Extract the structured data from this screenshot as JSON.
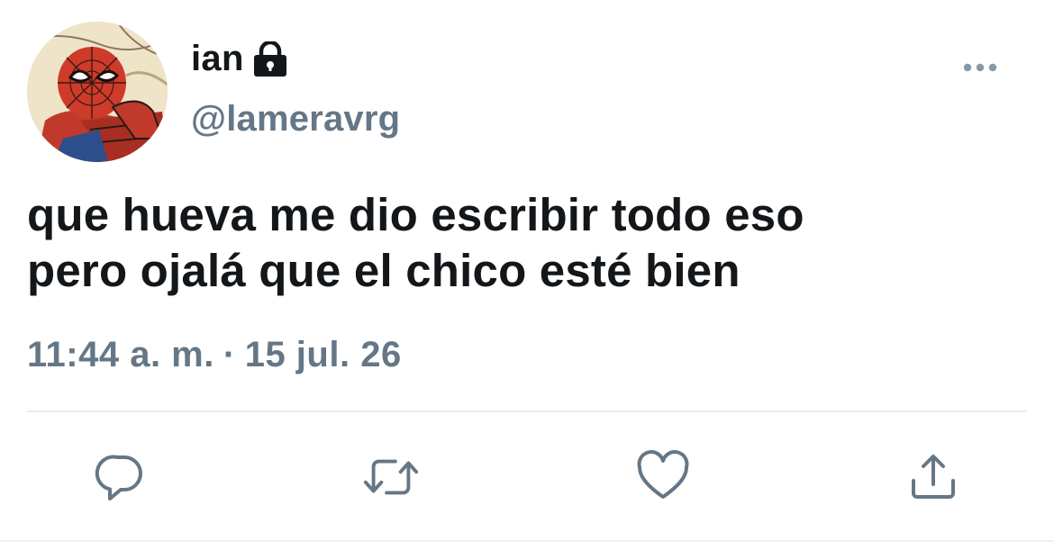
{
  "user": {
    "display_name": "ian",
    "handle": "@lameravrg",
    "avatar": "spiderman-avatar",
    "protected_icon": "lock-icon"
  },
  "tweet": {
    "lines": [
      "que hueva me dio escribir todo eso",
      "pero ojalá que el chico esté bien"
    ]
  },
  "meta": {
    "time": "11:44 a. m.",
    "separator": "·",
    "date": "15 jul. 26"
  },
  "actions": [
    {
      "icon": "reply-icon"
    },
    {
      "icon": "retweet-icon"
    },
    {
      "icon": "like-icon"
    },
    {
      "icon": "share-icon"
    }
  ],
  "more_icon": "more-options-icon",
  "colors": {
    "text_primary": "#14171a",
    "text_secondary": "#657786",
    "divider": "#e6ecf0"
  }
}
